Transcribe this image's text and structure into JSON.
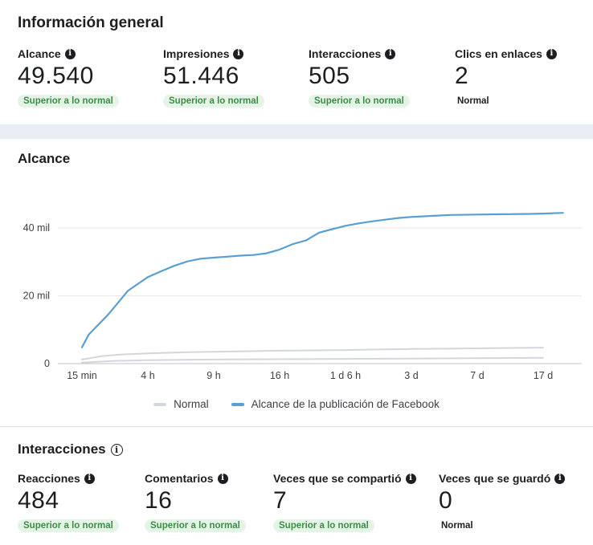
{
  "overview": {
    "title": "Información general",
    "metrics": [
      {
        "label": "Alcance",
        "value": "49.540",
        "badge": "Superior a lo normal"
      },
      {
        "label": "Impresiones",
        "value": "51.446",
        "badge": "Superior a lo normal"
      },
      {
        "label": "Interacciones",
        "value": "505",
        "badge": "Superior a lo normal"
      },
      {
        "label": "Clics en enlaces",
        "value": "2",
        "badge": "Normal"
      }
    ]
  },
  "reach_chart": {
    "title": "Alcance"
  },
  "chart_data": {
    "type": "line",
    "title": "Alcance",
    "x_categories": [
      "15 min",
      "4 h",
      "9 h",
      "16 h",
      "1 d 6 h",
      "3 d",
      "7 d",
      "17 d"
    ],
    "y_ticks": [
      "0",
      "20 mil",
      "40 mil"
    ],
    "ylim": [
      0,
      48000
    ],
    "grid": true,
    "legend_position": "bottom",
    "series": [
      {
        "name": "Normal",
        "color": "#d3d6db",
        "x": [
          0,
          0.3,
          0.6,
          1,
          1.5,
          2,
          2.5,
          3,
          3.5,
          4,
          4.5,
          5,
          5.5,
          6,
          6.5,
          7
        ],
        "y": [
          1200,
          2200,
          2700,
          3000,
          3300,
          3500,
          3650,
          3800,
          3900,
          4000,
          4150,
          4300,
          4400,
          4500,
          4600,
          4700
        ]
      },
      {
        "name": "Normal",
        "color": "#d3d6db",
        "x": [
          0,
          0.5,
          1,
          2,
          3,
          4,
          5,
          6,
          7
        ],
        "y": [
          300,
          800,
          1000,
          1200,
          1300,
          1400,
          1500,
          1600,
          1700
        ]
      },
      {
        "name": "Alcance de la publicación de Facebook",
        "color": "#5a9fd4",
        "x": [
          0,
          0.1,
          0.25,
          0.4,
          0.55,
          0.7,
          0.85,
          1,
          1.2,
          1.4,
          1.6,
          1.8,
          2,
          2.2,
          2.4,
          2.6,
          2.8,
          3,
          3.2,
          3.4,
          3.6,
          3.8,
          4,
          4.2,
          4.4,
          4.6,
          4.8,
          5,
          5.3,
          5.6,
          6,
          6.4,
          6.8,
          7,
          7.3
        ],
        "y": [
          4800,
          8500,
          11500,
          14500,
          18000,
          21500,
          23500,
          25500,
          27200,
          28800,
          30100,
          30900,
          31200,
          31500,
          31800,
          32000,
          32500,
          33600,
          35200,
          36300,
          38600,
          39600,
          40600,
          41300,
          41900,
          42400,
          42900,
          43200,
          43500,
          43800,
          43900,
          44000,
          44100,
          44200,
          44400
        ]
      }
    ]
  },
  "legend": {
    "items": [
      {
        "label": "Normal",
        "color": "#d3d6db"
      },
      {
        "label": "Alcance de la publicación de Facebook",
        "color": "#5a9fd4"
      }
    ]
  },
  "engagement": {
    "title": "Interacciones",
    "metrics": [
      {
        "label": "Reacciones",
        "value": "484",
        "badge": "Superior a lo normal"
      },
      {
        "label": "Comentarios",
        "value": "16",
        "badge": "Superior a lo normal"
      },
      {
        "label": "Veces que se compartió",
        "value": "7",
        "badge": "Superior a lo normal"
      },
      {
        "label": "Veces que se guardó",
        "value": "0",
        "badge": "Normal"
      }
    ]
  }
}
